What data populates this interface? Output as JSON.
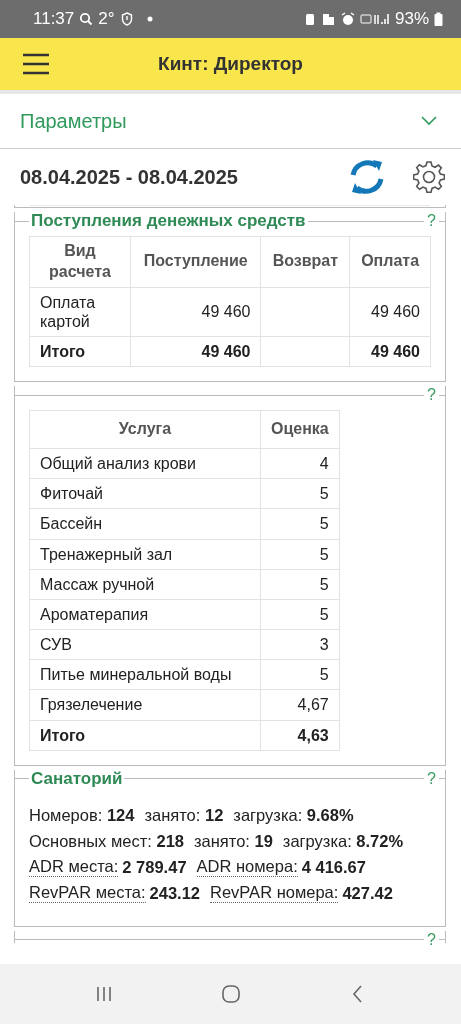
{
  "status_bar": {
    "time": "11:37",
    "temperature": "2°",
    "battery": "93%"
  },
  "app_bar": {
    "title": "Кинт: Директор"
  },
  "parameters": {
    "label": "Параметры",
    "expanded": false
  },
  "period": {
    "value": "08.04.2025 - 08.04.2025"
  },
  "panels": [
    {
      "kind": "table",
      "title": "Поступления денежных средств",
      "help": "?",
      "columns": [
        "Вид расчета",
        "Поступление",
        "Возврат",
        "Оплата"
      ],
      "rows": [
        {
          "kind": "row",
          "cells": [
            "Оплата картой",
            "49 460",
            null,
            "49 460"
          ]
        },
        {
          "kind": "total",
          "cells": [
            "Итого",
            "49 460",
            null,
            "49 460"
          ]
        }
      ]
    },
    {
      "kind": "table",
      "help": "?",
      "columns": [
        "Услуга",
        "Оценка"
      ],
      "rows": [
        {
          "kind": "row",
          "cells": [
            "Общий анализ крови",
            "4"
          ]
        },
        {
          "kind": "row",
          "cells": [
            "Фиточай",
            "5"
          ]
        },
        {
          "kind": "row",
          "cells": [
            "Бассейн",
            "5"
          ]
        },
        {
          "kind": "row",
          "cells": [
            "Тренажерный зал",
            "5"
          ]
        },
        {
          "kind": "row",
          "cells": [
            "Массаж ручной",
            "5"
          ]
        },
        {
          "kind": "row",
          "cells": [
            "Ароматерапия",
            "5"
          ]
        },
        {
          "kind": "row",
          "cells": [
            "СУВ",
            "3"
          ]
        },
        {
          "kind": "row",
          "cells": [
            "Питье минеральной воды",
            "5"
          ]
        },
        {
          "kind": "row",
          "cells": [
            "Грязелечение",
            "4,67"
          ]
        },
        {
          "kind": "total",
          "cells": [
            "Итого",
            "4,63"
          ]
        }
      ]
    },
    {
      "kind": "stats",
      "title": "Санаторий",
      "help": "?",
      "lines": [
        [
          {
            "kind": "text",
            "text": "Номеров: **124**"
          },
          {
            "kind": "text",
            "text": "занято: **12**"
          },
          {
            "kind": "text",
            "text": "загрузка: **9.68%**"
          }
        ],
        [
          {
            "kind": "text",
            "text": "Основных мест: **218**"
          },
          {
            "kind": "text",
            "text": "занято: **19**"
          },
          {
            "kind": "text",
            "text": "загрузка: **8.72%**"
          }
        ],
        [
          {
            "kind": "link",
            "label": "ADR места:",
            "value": "2 789.47"
          },
          {
            "kind": "link",
            "label": "ADR номера:",
            "value": "4 416.67"
          }
        ],
        [
          {
            "kind": "link",
            "label": "RevPAR места:",
            "value": "243.12"
          },
          {
            "kind": "link",
            "label": "RevPAR номера:",
            "value": "427.42"
          }
        ]
      ]
    },
    {
      "kind": "cut",
      "help": "?"
    }
  ]
}
